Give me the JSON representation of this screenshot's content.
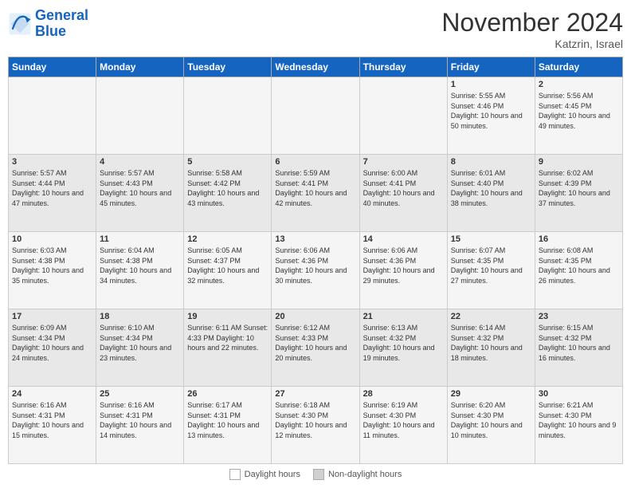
{
  "header": {
    "logo_line1": "General",
    "logo_line2": "Blue",
    "month_title": "November 2024",
    "location": "Katzrin, Israel"
  },
  "days_of_week": [
    "Sunday",
    "Monday",
    "Tuesday",
    "Wednesday",
    "Thursday",
    "Friday",
    "Saturday"
  ],
  "weeks": [
    [
      {
        "day": "",
        "info": ""
      },
      {
        "day": "",
        "info": ""
      },
      {
        "day": "",
        "info": ""
      },
      {
        "day": "",
        "info": ""
      },
      {
        "day": "",
        "info": ""
      },
      {
        "day": "1",
        "info": "Sunrise: 5:55 AM\nSunset: 4:46 PM\nDaylight: 10 hours and 50 minutes."
      },
      {
        "day": "2",
        "info": "Sunrise: 5:56 AM\nSunset: 4:45 PM\nDaylight: 10 hours and 49 minutes."
      }
    ],
    [
      {
        "day": "3",
        "info": "Sunrise: 5:57 AM\nSunset: 4:44 PM\nDaylight: 10 hours and 47 minutes."
      },
      {
        "day": "4",
        "info": "Sunrise: 5:57 AM\nSunset: 4:43 PM\nDaylight: 10 hours and 45 minutes."
      },
      {
        "day": "5",
        "info": "Sunrise: 5:58 AM\nSunset: 4:42 PM\nDaylight: 10 hours and 43 minutes."
      },
      {
        "day": "6",
        "info": "Sunrise: 5:59 AM\nSunset: 4:41 PM\nDaylight: 10 hours and 42 minutes."
      },
      {
        "day": "7",
        "info": "Sunrise: 6:00 AM\nSunset: 4:41 PM\nDaylight: 10 hours and 40 minutes."
      },
      {
        "day": "8",
        "info": "Sunrise: 6:01 AM\nSunset: 4:40 PM\nDaylight: 10 hours and 38 minutes."
      },
      {
        "day": "9",
        "info": "Sunrise: 6:02 AM\nSunset: 4:39 PM\nDaylight: 10 hours and 37 minutes."
      }
    ],
    [
      {
        "day": "10",
        "info": "Sunrise: 6:03 AM\nSunset: 4:38 PM\nDaylight: 10 hours and 35 minutes."
      },
      {
        "day": "11",
        "info": "Sunrise: 6:04 AM\nSunset: 4:38 PM\nDaylight: 10 hours and 34 minutes."
      },
      {
        "day": "12",
        "info": "Sunrise: 6:05 AM\nSunset: 4:37 PM\nDaylight: 10 hours and 32 minutes."
      },
      {
        "day": "13",
        "info": "Sunrise: 6:06 AM\nSunset: 4:36 PM\nDaylight: 10 hours and 30 minutes."
      },
      {
        "day": "14",
        "info": "Sunrise: 6:06 AM\nSunset: 4:36 PM\nDaylight: 10 hours and 29 minutes."
      },
      {
        "day": "15",
        "info": "Sunrise: 6:07 AM\nSunset: 4:35 PM\nDaylight: 10 hours and 27 minutes."
      },
      {
        "day": "16",
        "info": "Sunrise: 6:08 AM\nSunset: 4:35 PM\nDaylight: 10 hours and 26 minutes."
      }
    ],
    [
      {
        "day": "17",
        "info": "Sunrise: 6:09 AM\nSunset: 4:34 PM\nDaylight: 10 hours and 24 minutes."
      },
      {
        "day": "18",
        "info": "Sunrise: 6:10 AM\nSunset: 4:34 PM\nDaylight: 10 hours and 23 minutes."
      },
      {
        "day": "19",
        "info": "Sunrise: 6:11 AM\nSunset: 4:33 PM\nDaylight: 10 hours and 22 minutes."
      },
      {
        "day": "20",
        "info": "Sunrise: 6:12 AM\nSunset: 4:33 PM\nDaylight: 10 hours and 20 minutes."
      },
      {
        "day": "21",
        "info": "Sunrise: 6:13 AM\nSunset: 4:32 PM\nDaylight: 10 hours and 19 minutes."
      },
      {
        "day": "22",
        "info": "Sunrise: 6:14 AM\nSunset: 4:32 PM\nDaylight: 10 hours and 18 minutes."
      },
      {
        "day": "23",
        "info": "Sunrise: 6:15 AM\nSunset: 4:32 PM\nDaylight: 10 hours and 16 minutes."
      }
    ],
    [
      {
        "day": "24",
        "info": "Sunrise: 6:16 AM\nSunset: 4:31 PM\nDaylight: 10 hours and 15 minutes."
      },
      {
        "day": "25",
        "info": "Sunrise: 6:16 AM\nSunset: 4:31 PM\nDaylight: 10 hours and 14 minutes."
      },
      {
        "day": "26",
        "info": "Sunrise: 6:17 AM\nSunset: 4:31 PM\nDaylight: 10 hours and 13 minutes."
      },
      {
        "day": "27",
        "info": "Sunrise: 6:18 AM\nSunset: 4:30 PM\nDaylight: 10 hours and 12 minutes."
      },
      {
        "day": "28",
        "info": "Sunrise: 6:19 AM\nSunset: 4:30 PM\nDaylight: 10 hours and 11 minutes."
      },
      {
        "day": "29",
        "info": "Sunrise: 6:20 AM\nSunset: 4:30 PM\nDaylight: 10 hours and 10 minutes."
      },
      {
        "day": "30",
        "info": "Sunrise: 6:21 AM\nSunset: 4:30 PM\nDaylight: 10 hours and 9 minutes."
      }
    ]
  ],
  "footer": {
    "legend1_label": "Daylight hours",
    "legend1_color": "#ffffff",
    "legend2_label": "Non-daylight hours",
    "legend2_color": "#d0d0d0"
  },
  "colors": {
    "header_bg": "#1565c0",
    "odd_row": "#f5f5f5",
    "even_row": "#e8e8e8"
  }
}
